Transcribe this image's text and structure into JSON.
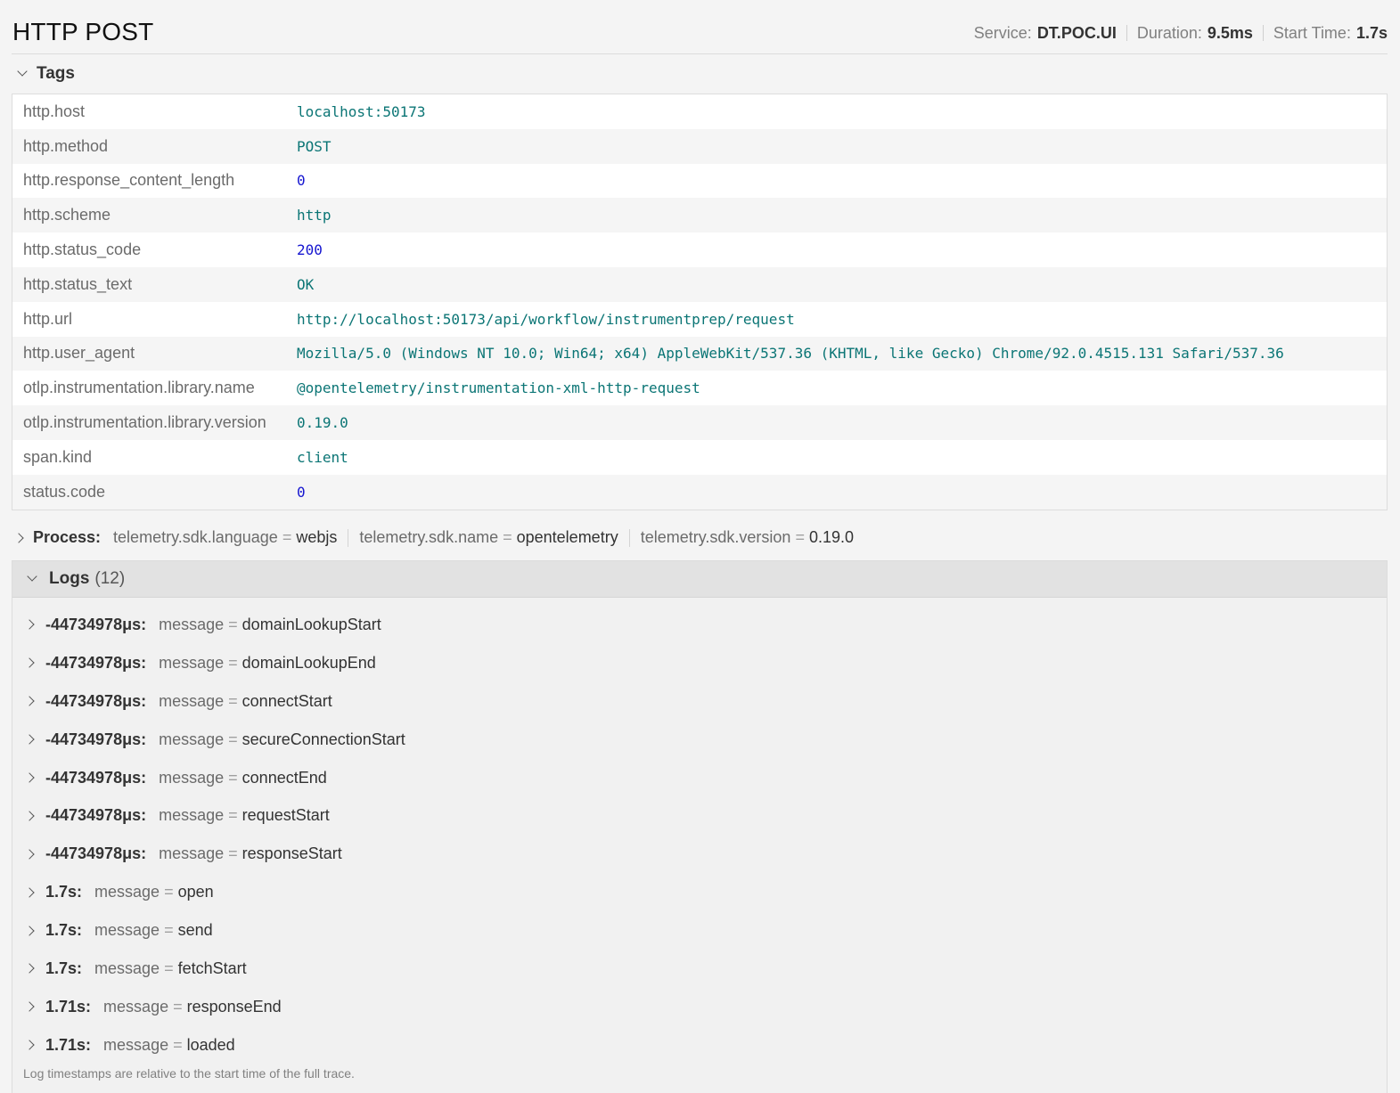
{
  "header": {
    "title": "HTTP POST",
    "service_label": "Service:",
    "service_value": "DT.POC.UI",
    "duration_label": "Duration:",
    "duration_value": "9.5ms",
    "start_label": "Start Time:",
    "start_value": "1.7s"
  },
  "tags": {
    "title": "Tags",
    "rows": [
      {
        "key": "http.host",
        "value": "localhost:50173",
        "numeric": false
      },
      {
        "key": "http.method",
        "value": "POST",
        "numeric": false
      },
      {
        "key": "http.response_content_length",
        "value": "0",
        "numeric": true
      },
      {
        "key": "http.scheme",
        "value": "http",
        "numeric": false
      },
      {
        "key": "http.status_code",
        "value": "200",
        "numeric": true
      },
      {
        "key": "http.status_text",
        "value": "OK",
        "numeric": false
      },
      {
        "key": "http.url",
        "value": "http://localhost:50173/api/workflow/instrumentprep/request",
        "numeric": false
      },
      {
        "key": "http.user_agent",
        "value": "Mozilla/5.0 (Windows NT 10.0; Win64; x64) AppleWebKit/537.36 (KHTML, like Gecko) Chrome/92.0.4515.131 Safari/537.36",
        "numeric": false
      },
      {
        "key": "otlp.instrumentation.library.name",
        "value": "@opentelemetry/instrumentation-xml-http-request",
        "numeric": false
      },
      {
        "key": "otlp.instrumentation.library.version",
        "value": "0.19.0",
        "numeric": false
      },
      {
        "key": "span.kind",
        "value": "client",
        "numeric": false
      },
      {
        "key": "status.code",
        "value": "0",
        "numeric": true
      }
    ]
  },
  "process": {
    "label": "Process:",
    "items": [
      {
        "key": "telemetry.sdk.language",
        "value": "webjs"
      },
      {
        "key": "telemetry.sdk.name",
        "value": "opentelemetry"
      },
      {
        "key": "telemetry.sdk.version",
        "value": "0.19.0"
      }
    ]
  },
  "logs": {
    "title": "Logs",
    "count": "(12)",
    "items": [
      {
        "ts": "-44734978μs:",
        "key": "message",
        "value": "domainLookupStart"
      },
      {
        "ts": "-44734978μs:",
        "key": "message",
        "value": "domainLookupEnd"
      },
      {
        "ts": "-44734978μs:",
        "key": "message",
        "value": "connectStart"
      },
      {
        "ts": "-44734978μs:",
        "key": "message",
        "value": "secureConnectionStart"
      },
      {
        "ts": "-44734978μs:",
        "key": "message",
        "value": "connectEnd"
      },
      {
        "ts": "-44734978μs:",
        "key": "message",
        "value": "requestStart"
      },
      {
        "ts": "-44734978μs:",
        "key": "message",
        "value": "responseStart"
      },
      {
        "ts": "1.7s:",
        "key": "message",
        "value": "open"
      },
      {
        "ts": "1.7s:",
        "key": "message",
        "value": "send"
      },
      {
        "ts": "1.7s:",
        "key": "message",
        "value": "fetchStart"
      },
      {
        "ts": "1.71s:",
        "key": "message",
        "value": "responseEnd"
      },
      {
        "ts": "1.71s:",
        "key": "message",
        "value": "loaded"
      }
    ],
    "footnote": "Log timestamps are relative to the start time of the full trace."
  },
  "icons": {
    "collapse": "chevron-down-icon",
    "expand": "chevron-right-icon"
  },
  "colors": {
    "tag_string": "#0b7575",
    "tag_number": "#1616d0"
  }
}
